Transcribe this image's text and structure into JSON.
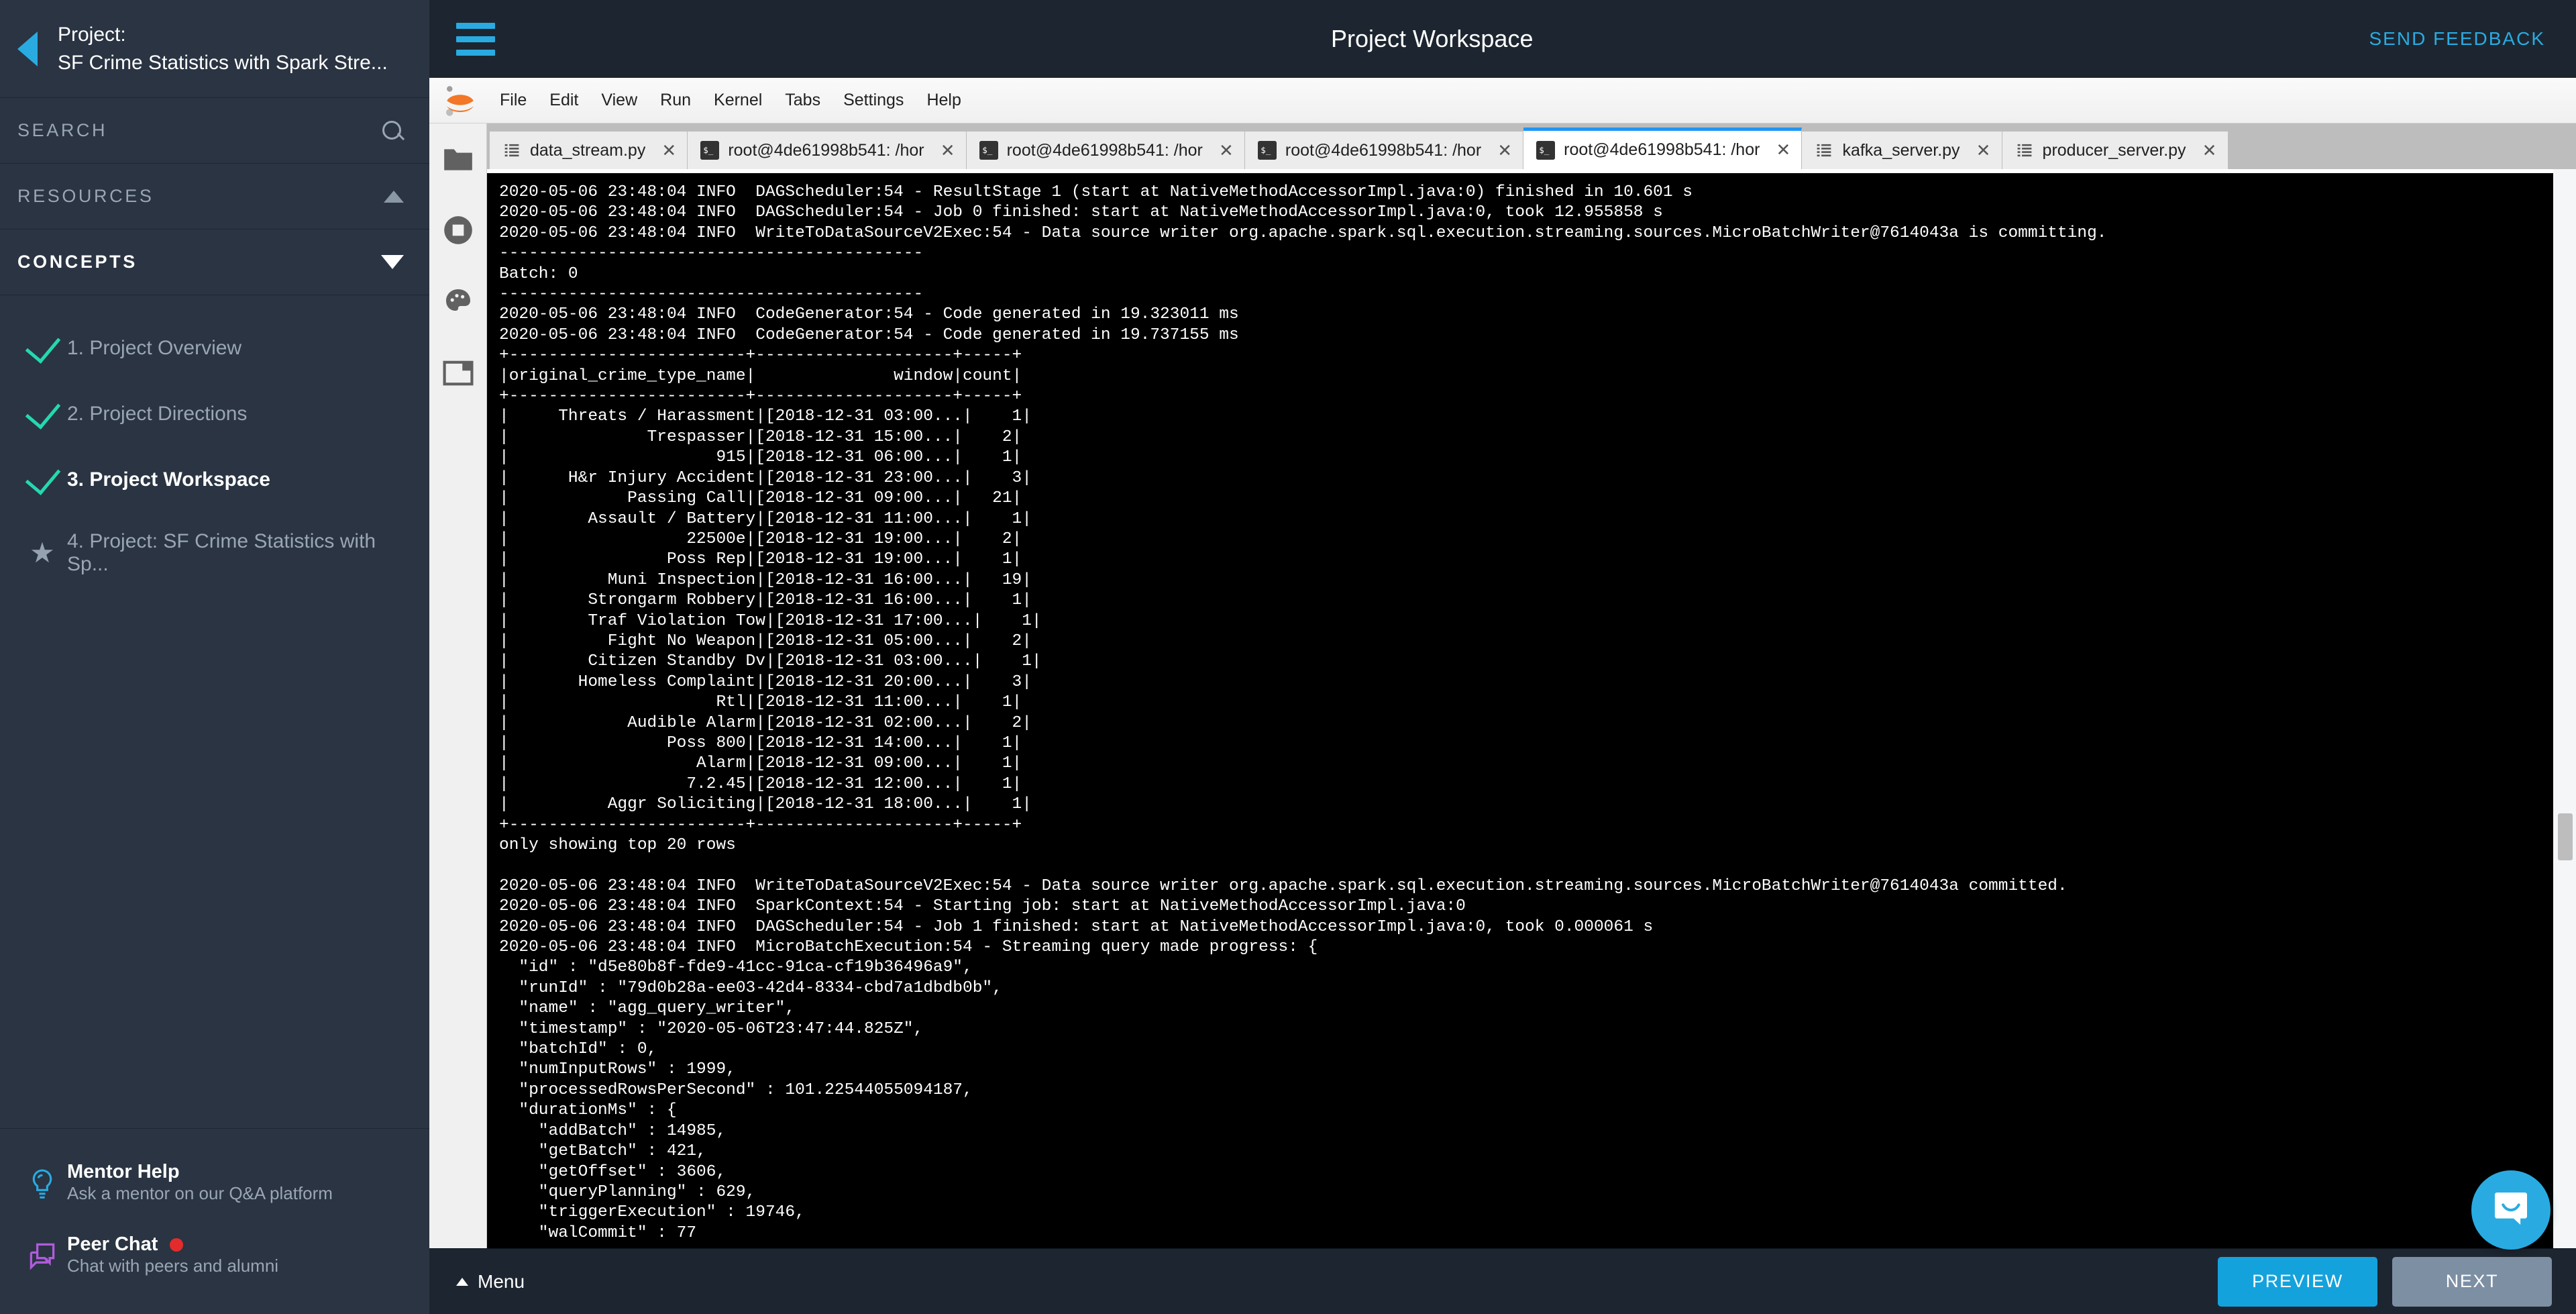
{
  "sidebar": {
    "back_icon": "back-triangle-icon",
    "project_label": "Project:",
    "project_name": "SF Crime Statistics with Spark Stre...",
    "search_label": "SEARCH",
    "search_icon": "search-icon",
    "resources_label": "RESOURCES",
    "resources_icon": "triangle-up-icon",
    "concepts_label": "CONCEPTS",
    "concepts_icon": "triangle-down-icon",
    "nav_items": [
      {
        "label": "1. Project Overview",
        "mark": "check",
        "current": false
      },
      {
        "label": "2. Project Directions",
        "mark": "check",
        "current": false
      },
      {
        "label": "3. Project Workspace",
        "mark": "check",
        "current": true
      },
      {
        "label": "4. Project: SF Crime Statistics with Sp...",
        "mark": "star",
        "current": false
      }
    ],
    "help": [
      {
        "icon": "lightbulb-icon",
        "title": "Mentor Help",
        "subtitle": "Ask a mentor on our Q&A platform",
        "badge": false
      },
      {
        "icon": "chat-bubbles-icon",
        "title": "Peer Chat",
        "subtitle": "Chat with peers and alumni",
        "badge": true
      }
    ]
  },
  "topbar": {
    "menu_icon": "hamburger-icon",
    "title": "Project Workspace",
    "feedback_label": "SEND FEEDBACK"
  },
  "jupyter": {
    "logo_icon": "jupyter-logo-icon",
    "menu": [
      "File",
      "Edit",
      "View",
      "Run",
      "Kernel",
      "Tabs",
      "Settings",
      "Help"
    ],
    "rail_icons": [
      "folder-icon",
      "running-terminals-icon",
      "palette-icon",
      "tabs-icon"
    ],
    "tabs": [
      {
        "label": "data_stream.py",
        "icon": "python-file-icon",
        "active": false
      },
      {
        "label": "root@4de61998b541: /hor",
        "icon": "terminal-icon",
        "active": false
      },
      {
        "label": "root@4de61998b541: /hor",
        "icon": "terminal-icon",
        "active": false
      },
      {
        "label": "root@4de61998b541: /hor",
        "icon": "terminal-icon",
        "active": false
      },
      {
        "label": "root@4de61998b541: /hor",
        "icon": "terminal-icon",
        "active": true
      },
      {
        "label": "kafka_server.py",
        "icon": "python-file-icon",
        "active": false
      },
      {
        "label": "producer_server.py",
        "icon": "python-file-icon",
        "active": false
      }
    ],
    "tab_close_glyph": "✕"
  },
  "terminal": {
    "lines": [
      "2020-05-06 23:48:04 INFO  DAGScheduler:54 - ResultStage 1 (start at NativeMethodAccessorImpl.java:0) finished in 10.601 s",
      "2020-05-06 23:48:04 INFO  DAGScheduler:54 - Job 0 finished: start at NativeMethodAccessorImpl.java:0, took 12.955858 s",
      "2020-05-06 23:48:04 INFO  WriteToDataSourceV2Exec:54 - Data source writer org.apache.spark.sql.execution.streaming.sources.MicroBatchWriter@7614043a is committing.",
      "-------------------------------------------",
      "Batch: 0",
      "-------------------------------------------",
      "2020-05-06 23:48:04 INFO  CodeGenerator:54 - Code generated in 19.323011 ms",
      "2020-05-06 23:48:04 INFO  CodeGenerator:54 - Code generated in 19.737155 ms",
      "+------------------------+--------------------+-----+",
      "|original_crime_type_name|              window|count|",
      "+------------------------+--------------------+-----+",
      "|     Threats / Harassment|[2018-12-31 03:00...|    1|",
      "|              Trespasser|[2018-12-31 15:00...|    2|",
      "|                     915|[2018-12-31 06:00...|    1|",
      "|      H&r Injury Accident|[2018-12-31 23:00...|    3|",
      "|            Passing Call|[2018-12-31 09:00...|   21|",
      "|        Assault / Battery|[2018-12-31 11:00...|    1|",
      "|                  22500e|[2018-12-31 19:00...|    2|",
      "|                Poss Rep|[2018-12-31 19:00...|    1|",
      "|          Muni Inspection|[2018-12-31 16:00...|   19|",
      "|        Strongarm Robbery|[2018-12-31 16:00...|    1|",
      "|        Traf Violation Tow|[2018-12-31 17:00...|    1|",
      "|          Fight No Weapon|[2018-12-31 05:00...|    2|",
      "|        Citizen Standby Dv|[2018-12-31 03:00...|    1|",
      "|       Homeless Complaint|[2018-12-31 20:00...|    3|",
      "|                     Rtl|[2018-12-31 11:00...|    1|",
      "|            Audible Alarm|[2018-12-31 02:00...|    2|",
      "|                Poss 800|[2018-12-31 14:00...|    1|",
      "|                   Alarm|[2018-12-31 09:00...|    1|",
      "|                  7.2.45|[2018-12-31 12:00...|    1|",
      "|          Aggr Soliciting|[2018-12-31 18:00...|    1|",
      "+------------------------+--------------------+-----+",
      "only showing top 20 rows",
      "",
      "2020-05-06 23:48:04 INFO  WriteToDataSourceV2Exec:54 - Data source writer org.apache.spark.sql.execution.streaming.sources.MicroBatchWriter@7614043a committed.",
      "2020-05-06 23:48:04 INFO  SparkContext:54 - Starting job: start at NativeMethodAccessorImpl.java:0",
      "2020-05-06 23:48:04 INFO  DAGScheduler:54 - Job 1 finished: start at NativeMethodAccessorImpl.java:0, took 0.000061 s",
      "2020-05-06 23:48:04 INFO  MicroBatchExecution:54 - Streaming query made progress: {",
      "  \"id\" : \"d5e80b8f-fde9-41cc-91ca-cf19b36496a9\",",
      "  \"runId\" : \"79d0b28a-ee03-42d4-8334-cbd7a1dbdb0b\",",
      "  \"name\" : \"agg_query_writer\",",
      "  \"timestamp\" : \"2020-05-06T23:47:44.825Z\",",
      "  \"batchId\" : 0,",
      "  \"numInputRows\" : 1999,",
      "  \"processedRowsPerSecond\" : 101.22544055094187,",
      "  \"durationMs\" : {",
      "    \"addBatch\" : 14985,",
      "    \"getBatch\" : 421,",
      "    \"getOffset\" : 3606,",
      "    \"queryPlanning\" : 629,",
      "    \"triggerExecution\" : 19746,",
      "    \"walCommit\" : 77"
    ],
    "table": {
      "batch_label": "Batch: 0",
      "columns": [
        "original_crime_type_name",
        "window",
        "count"
      ],
      "rows": [
        [
          "Threats / Harassment",
          "[2018-12-31 03:00...",
          "1"
        ],
        [
          "Trespasser",
          "[2018-12-31 15:00...",
          "2"
        ],
        [
          "915",
          "[2018-12-31 06:00...",
          "1"
        ],
        [
          "H&r Injury Accident",
          "[2018-12-31 23:00...",
          "3"
        ],
        [
          "Passing Call",
          "[2018-12-31 09:00...",
          "21"
        ],
        [
          "Assault / Battery",
          "[2018-12-31 11:00...",
          "1"
        ],
        [
          "22500e",
          "[2018-12-31 19:00...",
          "2"
        ],
        [
          "Poss Rep",
          "[2018-12-31 19:00...",
          "1"
        ],
        [
          "Muni Inspection",
          "[2018-12-31 16:00...",
          "19"
        ],
        [
          "Strongarm Robbery",
          "[2018-12-31 16:00...",
          "1"
        ],
        [
          "Traf Violation Tow",
          "[2018-12-31 17:00...",
          "1"
        ],
        [
          "Fight No Weapon",
          "[2018-12-31 05:00...",
          "2"
        ],
        [
          "Citizen Standby Dv",
          "[2018-12-31 03:00...",
          "1"
        ],
        [
          "Homeless Complaint",
          "[2018-12-31 20:00...",
          "3"
        ],
        [
          "Rtl",
          "[2018-12-31 11:00...",
          "1"
        ],
        [
          "Audible Alarm",
          "[2018-12-31 02:00...",
          "2"
        ],
        [
          "Poss 800",
          "[2018-12-31 14:00...",
          "1"
        ],
        [
          "Alarm",
          "[2018-12-31 09:00...",
          "1"
        ],
        [
          "7.2.45",
          "[2018-12-31 12:00...",
          "1"
        ],
        [
          "Aggr Soliciting",
          "[2018-12-31 18:00...",
          "1"
        ]
      ],
      "footer": "only showing top 20 rows"
    }
  },
  "bottombar": {
    "menu_label": "Menu",
    "menu_icon": "caret-up-icon",
    "preview_label": "PREVIEW",
    "next_label": "NEXT"
  },
  "chat_widget": {
    "icon": "chat-smile-icon"
  },
  "colors": {
    "accent": "#29ABE2",
    "sidebar_bg": "#2a3442",
    "topbar_bg": "#1d2630",
    "check_green": "#24d8b0",
    "badge_red": "#e32b2b",
    "terminal_bg": "#000000",
    "terminal_fg": "#ffffff",
    "preview_btn": "#14a2dc",
    "next_btn": "#7d8fa3"
  }
}
